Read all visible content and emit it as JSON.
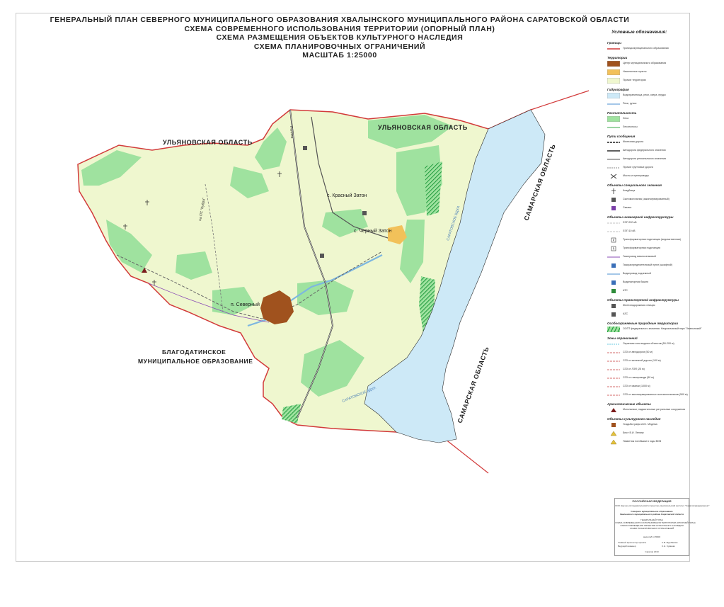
{
  "title": {
    "lines": [
      "ГЕНЕРАЛЬНЫЙ ПЛАН СЕВЕРНОГО МУНИЦИПАЛЬНОГО ОБРАЗОВАНИЯ ХВАЛЫНСКОГО МУНИЦИПАЛЬНОГО РАЙОНА САРАТОВСКОЙ  ОБЛАСТИ",
      "СХЕМА СОВРЕМЕННОГО ИСПОЛЬЗОВАНИЯ ТЕРРИТОРИИ (ОПОРНЫЙ ПЛАН)",
      "СХЕМА РАЗМЕЩЕНИЯ ОБЪЕКТОВ КУЛЬТУРНОГО НАСЛЕДИЯ",
      "СХЕМА ПЛАНИРОВОЧНЫХ ОГРАНИЧЕНИЙ",
      "МАСШТАБ 1:25000"
    ]
  },
  "map": {
    "regions": {
      "ulyanovsk_left": "УЛЬЯНОВСКАЯ ОБЛАСТЬ",
      "ulyanovsk_right": "УЛЬЯНОВСКАЯ ОБЛАСТЬ",
      "samara_top": "САМАРСКАЯ ОБЛАСТЬ",
      "samara_bottom": "САМАРСКАЯ ОБЛАСТЬ",
      "blagodatinskoe_1": "БЛАГОДАТИНСКОЕ",
      "blagodatinskoe_2": "МУНИЦИПАЛЬНОЕ ОБРАЗОВАНИЕ"
    },
    "settlements": {
      "severny": "п. Северный",
      "krasny_zaton": "с. Красный Затон",
      "cherny_zaton": "с. Черный Затон"
    },
    "reservoir_labels": {
      "upper": "САРАТОВСКОЕ ВДХР.",
      "lower": "САРАТОВСКОЕ ВДХР."
    },
    "road_labels": {
      "road_1": "на ПС \"Кубра\"",
      "road_2": "Поляна"
    },
    "colors": {
      "boundary": "#d23a3a",
      "territory": "#eff7cf",
      "forest": "#9fe29f",
      "water": "#cde9f7",
      "settlement": "#a0521e",
      "cherny_zaton": "#f2c15a",
      "protected": "#1f9a3c",
      "road": "#2c2c2c"
    }
  },
  "legend": {
    "title": "Условные обозначения:",
    "items": [
      {
        "head": "Границы"
      },
      {
        "text": "Граница муниципального образования",
        "sym": "boundary"
      },
      {
        "head": "Территории"
      },
      {
        "text": "Центр муниципального образования",
        "sym": "fill-brown"
      },
      {
        "text": "Населенные пункты",
        "sym": "fill-yellow"
      },
      {
        "text": "Прочие территории",
        "sym": "fill-light"
      },
      {
        "head": "Гидрография"
      },
      {
        "text": "Водохранилища, реки, озера, пруды",
        "sym": "fill-water"
      },
      {
        "text": "Реки, ручьи",
        "sym": "line-blue"
      },
      {
        "head": "Растительность"
      },
      {
        "text": "Леса",
        "sym": "fill-forest"
      },
      {
        "text": "Лесополосы",
        "sym": "line-green"
      },
      {
        "head": "Пути сообщения"
      },
      {
        "text": "Железная дорога",
        "sym": "line-rail"
      },
      {
        "text": "Автодорога федерального значения",
        "sym": "line-black"
      },
      {
        "text": "Автодорога регионального значения",
        "sym": "line-gray"
      },
      {
        "text": "Прочие грунтовые дороги",
        "sym": "line-dash"
      },
      {
        "text": "Мосты и путепроводы",
        "sym": "bridge"
      },
      {
        "head": "Объекты специального значения"
      },
      {
        "text": "Кладбища",
        "sym": "cross"
      },
      {
        "text": "Скотомогильник (законсервированный)",
        "sym": "square-dark"
      },
      {
        "text": "Свалка",
        "sym": "square-purple"
      },
      {
        "head": "Объекты инженерной инфраструктуры"
      },
      {
        "text": "ЛЭП 220 кВ",
        "sym": "line-thin"
      },
      {
        "text": "ЛЭП 10 кВ",
        "sym": "line-thin"
      },
      {
        "text": "Трансформаторная подстанция (ведомственная)",
        "sym": "sub"
      },
      {
        "text": "Трансформаторная подстанция",
        "sym": "sub"
      },
      {
        "text": "Газопровод межпоселковый",
        "sym": "line-purple"
      },
      {
        "text": "Газораспределительный пункт (шкафной)",
        "sym": "square-blue"
      },
      {
        "text": "Водопровод подземный",
        "sym": "line-blue"
      },
      {
        "text": "Водонапорная башня",
        "sym": "square-blue"
      },
      {
        "text": "АТС",
        "sym": "square-green"
      },
      {
        "head": "Объекты транспортной инфраструктуры"
      },
      {
        "text": "Железнодорожная станция",
        "sym": "square-dark"
      },
      {
        "text": "АЗС",
        "sym": "square-dark"
      },
      {
        "head": "Особоохраняемые природные территории"
      },
      {
        "text": "ООПТ федерального значения. Национальный парк \"Хвалынский\"",
        "sym": "hatch"
      },
      {
        "head": "Зоны ограничений"
      },
      {
        "text": "Охранная зона водных объектов (50-200 м)",
        "sym": "line-cyan"
      },
      {
        "text": "СЗЗ от автодороги (50 м)",
        "sym": "line-red-dash"
      },
      {
        "text": "СЗЗ от железной дороги (100 м)",
        "sym": "line-red-dash"
      },
      {
        "text": "СЗЗ от ЛЭП (25 м)",
        "sym": "line-red-dash"
      },
      {
        "text": "СЗЗ от газопровода (50 м)",
        "sym": "line-red-dash"
      },
      {
        "text": "СЗЗ от свалки (1000 м)",
        "sym": "line-red-dash"
      },
      {
        "text": "СЗЗ от законсервированных скотомогильников (500 м)",
        "sym": "line-red-dash"
      },
      {
        "head": "Археологические объекты"
      },
      {
        "text": "Могильники, надмогильные ритуальные сооружения",
        "sym": "tri-dark"
      },
      {
        "head": "Объекты культурного наследия"
      },
      {
        "text": "Усадьба графа А.Ю. Медема",
        "sym": "square-brown"
      },
      {
        "text": "Бюст В.И. Ленину",
        "sym": "tri-yellow"
      },
      {
        "text": "Памятник погибшим в годы ВОВ",
        "sym": "tri-yellow"
      }
    ]
  },
  "stamp": {
    "head": "РОССИЙСКАЯ ФЕДЕРАЦИЯ",
    "lines": [
      "ООО Научно-исследовательский и проектно-изыскательский институт \"Саратовгражданпроект\"",
      "Северное муниципальное образование",
      "Хвалынского муниципального района Саратовской области",
      "ГЕНЕРАЛЬНЫЙ ПЛАН",
      "СХЕМА СОВРЕМЕННОГО ИСПОЛЬЗОВАНИЯ ТЕРРИТОРИИ (ОПОРНЫЙ ПЛАН)",
      "СХЕМА РАЗМЕЩЕНИЯ ОБЪЕКТОВ КУЛЬТУРНОГО НАСЛЕДИЯ",
      "СХЕМА ПЛАНИРОВОЧНЫХ ОГРАНИЧЕНИЙ"
    ],
    "scale": "масштаб 1:25000",
    "chief": "Главный архитектор проекта",
    "chief_name": "С.В. Щербакова",
    "lead": "Ведущий инженер",
    "lead_name": "С.Н. Суменко",
    "city_year": "Саратов 2010"
  }
}
